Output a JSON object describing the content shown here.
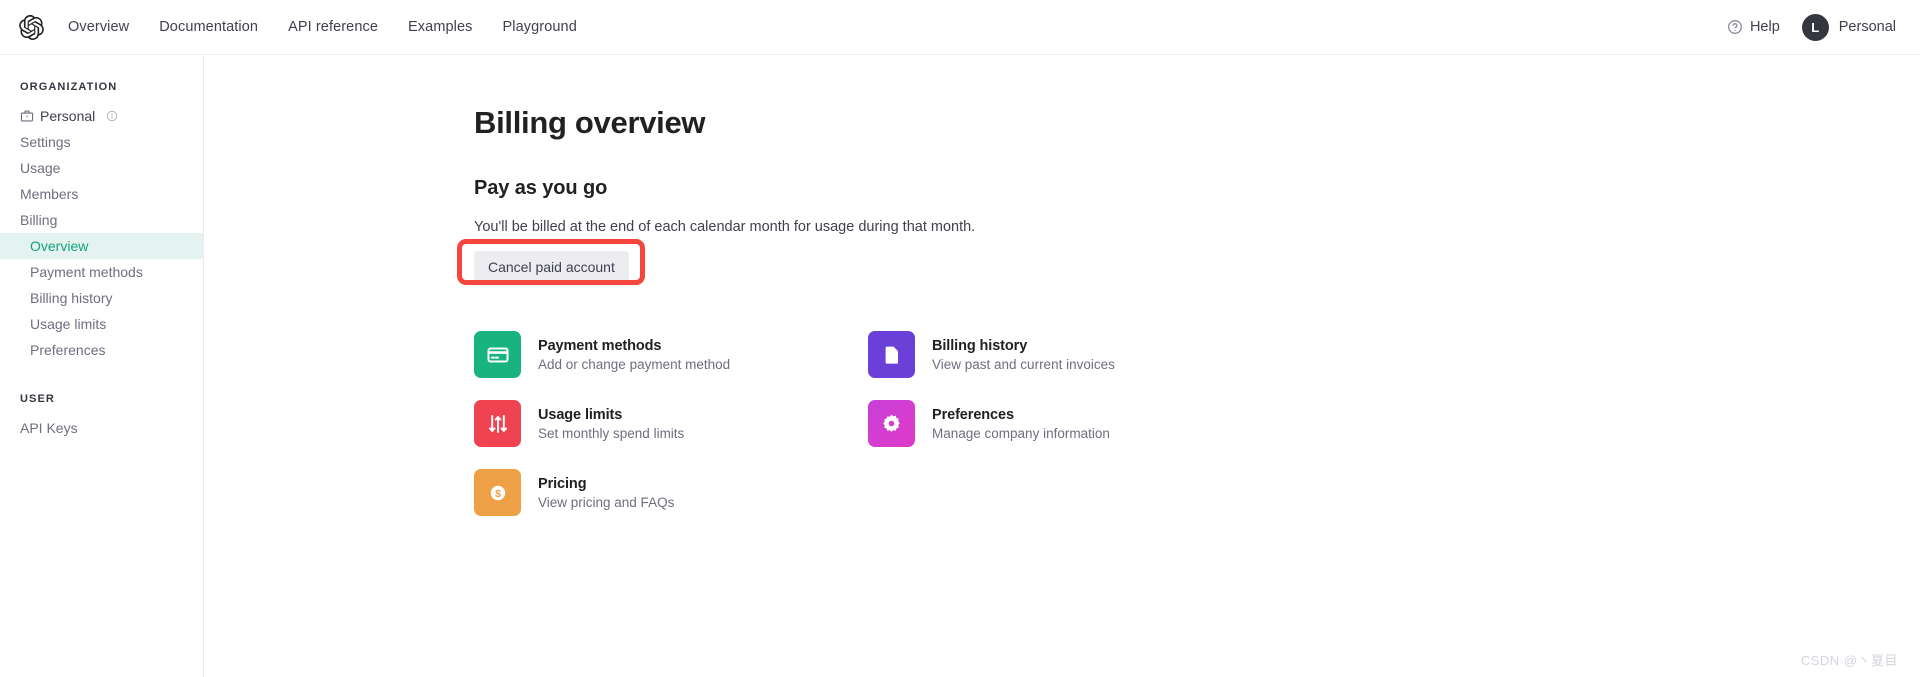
{
  "topnav": {
    "logo_icon": "openai-logo-icon",
    "links": [
      {
        "label": "Overview"
      },
      {
        "label": "Documentation"
      },
      {
        "label": "API reference"
      },
      {
        "label": "Examples"
      },
      {
        "label": "Playground"
      }
    ],
    "help": {
      "label": "Help",
      "icon": "question-circle-icon"
    },
    "account": {
      "avatar_initial": "L",
      "name": "Personal"
    }
  },
  "sidebar": {
    "organization_heading": "ORGANIZATION",
    "org_items": [
      {
        "label": "Personal",
        "icon": "briefcase-icon",
        "trailing_icon": "info-circle-icon",
        "active": false
      },
      {
        "label": "Settings",
        "active": false
      },
      {
        "label": "Usage",
        "active": false
      },
      {
        "label": "Members",
        "active": false
      },
      {
        "label": "Billing",
        "active": false
      }
    ],
    "billing_subitems": [
      {
        "label": "Overview",
        "active": true
      },
      {
        "label": "Payment methods",
        "active": false
      },
      {
        "label": "Billing history",
        "active": false
      },
      {
        "label": "Usage limits",
        "active": false
      },
      {
        "label": "Preferences",
        "active": false
      }
    ],
    "user_heading": "USER",
    "user_items": [
      {
        "label": "API Keys"
      }
    ],
    "active_bg": "#e4f3ef",
    "active_color": "#10a37f"
  },
  "main": {
    "page_title": "Billing overview",
    "section_title": "Pay as you go",
    "section_desc": "You'll be billed at the end of each calendar month for usage during that month.",
    "cancel_button_label": "Cancel paid account",
    "annotation_color": "#f4463c",
    "cards": [
      {
        "title": "Payment methods",
        "subtitle": "Add or change payment method",
        "icon": "credit-card-icon",
        "color": "#18b37f"
      },
      {
        "title": "Billing history",
        "subtitle": "View past and current invoices",
        "icon": "document-icon",
        "color": "#6b40d8"
      },
      {
        "title": "Usage limits",
        "subtitle": "Set monthly spend limits",
        "icon": "sliders-icon",
        "color": "#ef4352"
      },
      {
        "title": "Preferences",
        "subtitle": "Manage company information",
        "icon": "gear-icon",
        "color": "#d63ad6"
      },
      {
        "title": "Pricing",
        "subtitle": "View pricing and FAQs",
        "icon": "dollar-coin-icon",
        "color": "#eda045"
      }
    ]
  },
  "watermark": "CSDN @丶夏目"
}
